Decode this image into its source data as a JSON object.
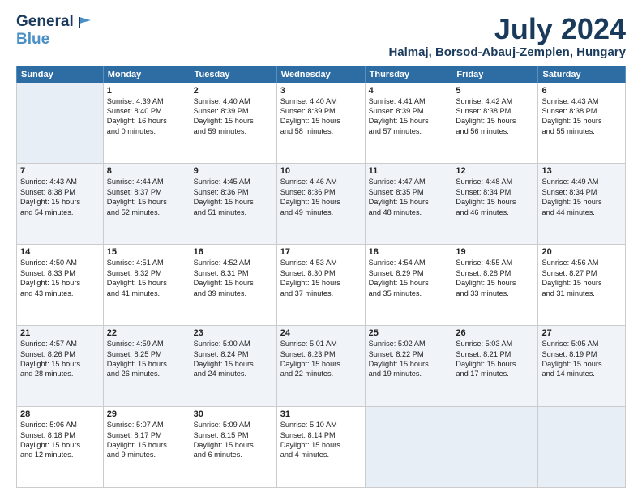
{
  "header": {
    "logo_line1": "General",
    "logo_line2": "Blue",
    "month": "July 2024",
    "location": "Halmaj, Borsod-Abauj-Zemplen, Hungary"
  },
  "weekdays": [
    "Sunday",
    "Monday",
    "Tuesday",
    "Wednesday",
    "Thursday",
    "Friday",
    "Saturday"
  ],
  "weeks": [
    [
      {
        "day": "",
        "info": ""
      },
      {
        "day": "1",
        "info": "Sunrise: 4:39 AM\nSunset: 8:40 PM\nDaylight: 16 hours\nand 0 minutes."
      },
      {
        "day": "2",
        "info": "Sunrise: 4:40 AM\nSunset: 8:39 PM\nDaylight: 15 hours\nand 59 minutes."
      },
      {
        "day": "3",
        "info": "Sunrise: 4:40 AM\nSunset: 8:39 PM\nDaylight: 15 hours\nand 58 minutes."
      },
      {
        "day": "4",
        "info": "Sunrise: 4:41 AM\nSunset: 8:39 PM\nDaylight: 15 hours\nand 57 minutes."
      },
      {
        "day": "5",
        "info": "Sunrise: 4:42 AM\nSunset: 8:38 PM\nDaylight: 15 hours\nand 56 minutes."
      },
      {
        "day": "6",
        "info": "Sunrise: 4:43 AM\nSunset: 8:38 PM\nDaylight: 15 hours\nand 55 minutes."
      }
    ],
    [
      {
        "day": "7",
        "info": "Sunrise: 4:43 AM\nSunset: 8:38 PM\nDaylight: 15 hours\nand 54 minutes."
      },
      {
        "day": "8",
        "info": "Sunrise: 4:44 AM\nSunset: 8:37 PM\nDaylight: 15 hours\nand 52 minutes."
      },
      {
        "day": "9",
        "info": "Sunrise: 4:45 AM\nSunset: 8:36 PM\nDaylight: 15 hours\nand 51 minutes."
      },
      {
        "day": "10",
        "info": "Sunrise: 4:46 AM\nSunset: 8:36 PM\nDaylight: 15 hours\nand 49 minutes."
      },
      {
        "day": "11",
        "info": "Sunrise: 4:47 AM\nSunset: 8:35 PM\nDaylight: 15 hours\nand 48 minutes."
      },
      {
        "day": "12",
        "info": "Sunrise: 4:48 AM\nSunset: 8:34 PM\nDaylight: 15 hours\nand 46 minutes."
      },
      {
        "day": "13",
        "info": "Sunrise: 4:49 AM\nSunset: 8:34 PM\nDaylight: 15 hours\nand 44 minutes."
      }
    ],
    [
      {
        "day": "14",
        "info": "Sunrise: 4:50 AM\nSunset: 8:33 PM\nDaylight: 15 hours\nand 43 minutes."
      },
      {
        "day": "15",
        "info": "Sunrise: 4:51 AM\nSunset: 8:32 PM\nDaylight: 15 hours\nand 41 minutes."
      },
      {
        "day": "16",
        "info": "Sunrise: 4:52 AM\nSunset: 8:31 PM\nDaylight: 15 hours\nand 39 minutes."
      },
      {
        "day": "17",
        "info": "Sunrise: 4:53 AM\nSunset: 8:30 PM\nDaylight: 15 hours\nand 37 minutes."
      },
      {
        "day": "18",
        "info": "Sunrise: 4:54 AM\nSunset: 8:29 PM\nDaylight: 15 hours\nand 35 minutes."
      },
      {
        "day": "19",
        "info": "Sunrise: 4:55 AM\nSunset: 8:28 PM\nDaylight: 15 hours\nand 33 minutes."
      },
      {
        "day": "20",
        "info": "Sunrise: 4:56 AM\nSunset: 8:27 PM\nDaylight: 15 hours\nand 31 minutes."
      }
    ],
    [
      {
        "day": "21",
        "info": "Sunrise: 4:57 AM\nSunset: 8:26 PM\nDaylight: 15 hours\nand 28 minutes."
      },
      {
        "day": "22",
        "info": "Sunrise: 4:59 AM\nSunset: 8:25 PM\nDaylight: 15 hours\nand 26 minutes."
      },
      {
        "day": "23",
        "info": "Sunrise: 5:00 AM\nSunset: 8:24 PM\nDaylight: 15 hours\nand 24 minutes."
      },
      {
        "day": "24",
        "info": "Sunrise: 5:01 AM\nSunset: 8:23 PM\nDaylight: 15 hours\nand 22 minutes."
      },
      {
        "day": "25",
        "info": "Sunrise: 5:02 AM\nSunset: 8:22 PM\nDaylight: 15 hours\nand 19 minutes."
      },
      {
        "day": "26",
        "info": "Sunrise: 5:03 AM\nSunset: 8:21 PM\nDaylight: 15 hours\nand 17 minutes."
      },
      {
        "day": "27",
        "info": "Sunrise: 5:05 AM\nSunset: 8:19 PM\nDaylight: 15 hours\nand 14 minutes."
      }
    ],
    [
      {
        "day": "28",
        "info": "Sunrise: 5:06 AM\nSunset: 8:18 PM\nDaylight: 15 hours\nand 12 minutes."
      },
      {
        "day": "29",
        "info": "Sunrise: 5:07 AM\nSunset: 8:17 PM\nDaylight: 15 hours\nand 9 minutes."
      },
      {
        "day": "30",
        "info": "Sunrise: 5:09 AM\nSunset: 8:15 PM\nDaylight: 15 hours\nand 6 minutes."
      },
      {
        "day": "31",
        "info": "Sunrise: 5:10 AM\nSunset: 8:14 PM\nDaylight: 15 hours\nand 4 minutes."
      },
      {
        "day": "",
        "info": ""
      },
      {
        "day": "",
        "info": ""
      },
      {
        "day": "",
        "info": ""
      }
    ]
  ]
}
